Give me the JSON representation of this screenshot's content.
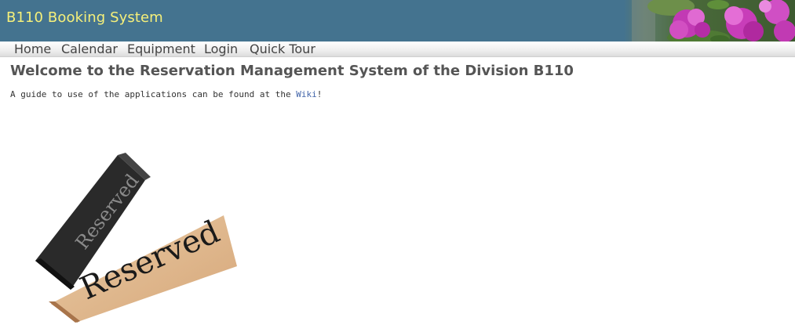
{
  "header": {
    "title": "B110 Booking System",
    "banner_icon": "flowers-image"
  },
  "nav": {
    "items": [
      {
        "label": "Home"
      },
      {
        "label": "Calendar"
      },
      {
        "label": "Equipment"
      },
      {
        "label": "Login"
      },
      {
        "label": "Quick Tour"
      }
    ]
  },
  "main": {
    "title": "Welcome to the Reservation Management System of the Division B110",
    "guide_text_before": "A guide to use of the applications can be found at the ",
    "guide_link_text": "Wiki",
    "guide_text_after": "!",
    "image": {
      "front_sign_text": "Reserved",
      "back_sign_text": "Reserved"
    }
  },
  "colors": {
    "header_bg": "#44738f",
    "brand_text": "#f6f07a",
    "link": "#4466aa"
  }
}
